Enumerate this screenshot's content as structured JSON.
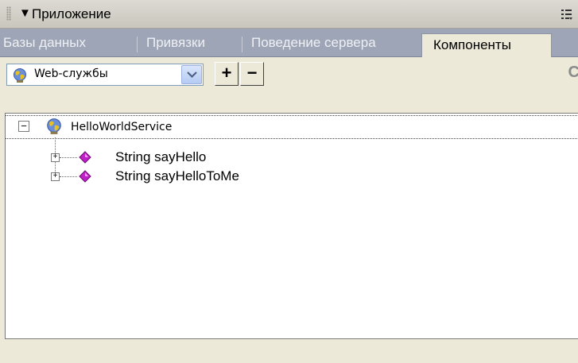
{
  "panel": {
    "title": "Приложение",
    "collapse_glyph": "▼"
  },
  "tabs": [
    {
      "label": "Базы данных",
      "active": false
    },
    {
      "label": "Привязки",
      "active": false
    },
    {
      "label": "Поведение сервера",
      "active": false
    },
    {
      "label": "Компоненты",
      "active": true
    }
  ],
  "toolbar": {
    "component_type": "Web-службы",
    "add_label": "+",
    "remove_label": "−",
    "clipped_label": "C"
  },
  "tree": {
    "root": {
      "label": "HelloWorldService",
      "expander": "−"
    },
    "children": [
      {
        "label": "String sayHello",
        "expander": "+"
      },
      {
        "label": "String sayHelloToMe",
        "expander": "+"
      }
    ]
  },
  "colors": {
    "tab_bar": "#9da5b6",
    "method_icon": "#c020c8",
    "panel_bg": "#ece9d8"
  },
  "icons": {
    "service": "globe-service-icon",
    "method": "method-diamond-icon",
    "options": "panel-options-icon"
  }
}
